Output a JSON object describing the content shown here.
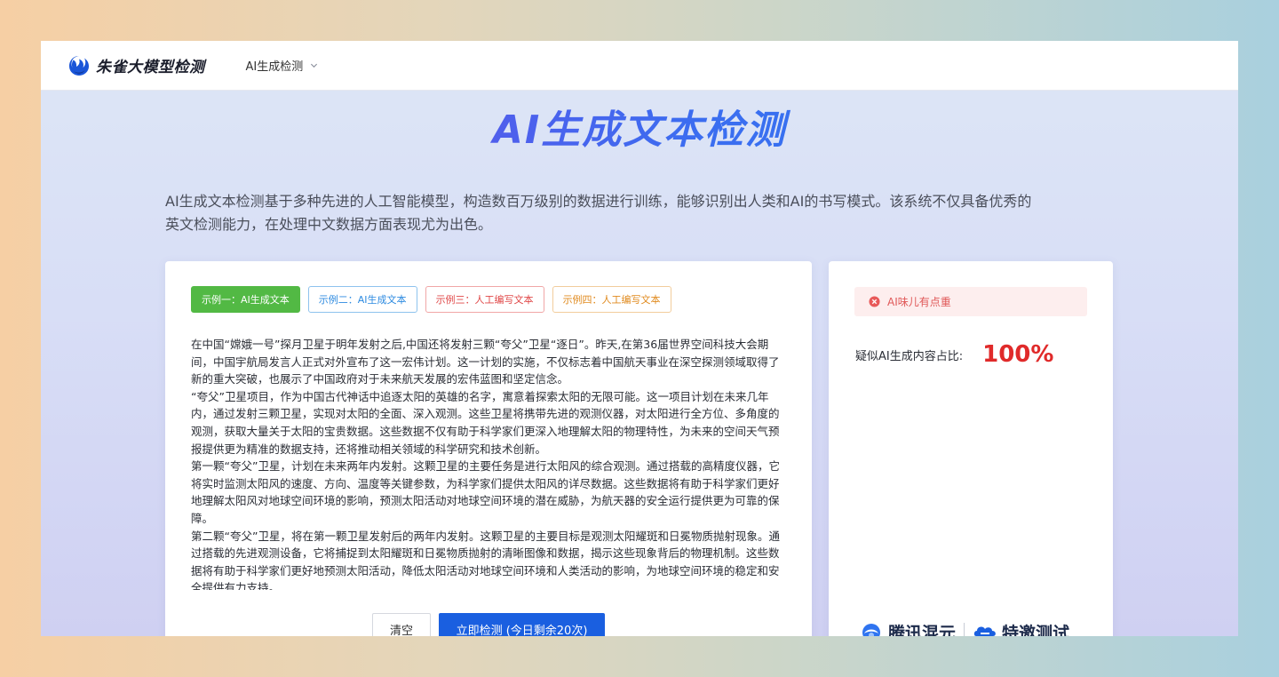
{
  "header": {
    "logo_text": "朱雀大模型检测",
    "nav_label": "AI生成检测"
  },
  "hero": {
    "title": "AI生成文本检测",
    "intro_line1": "AI生成文本检测基于多种先进的人工智能模型，构造数百万级别的数据进行训练，能够识别出人类和AI的书写模式。该系统不仅具备优秀的",
    "intro_line2": "英文检测能力，在处理中文数据方面表现尤为出色。"
  },
  "examples": [
    {
      "label": "示例一：AI生成文本",
      "color": "#52b944"
    },
    {
      "label": "示例二：AI生成文本",
      "color": "#2c8ae0"
    },
    {
      "label": "示例三：人工编写文本",
      "color": "#e04848"
    },
    {
      "label": "示例四：人工编写文本",
      "color": "#e08a1e"
    }
  ],
  "text_paragraphs": [
    "在中国“嫦娥一号”探月卫星于明年发射之后,中国还将发射三颗“夸父”卫星“逐日”。昨天,在第36届世界空间科技大会期间，中国宇航局发言人正式对外宣布了这一宏伟计划。这一计划的实施，不仅标志着中国航天事业在深空探测领域取得了新的重大突破，也展示了中国政府对于未来航天发展的宏伟蓝图和坚定信念。",
    "“夸父”卫星项目，作为中国古代神话中追逐太阳的英雄的名字，寓意着探索太阳的无限可能。这一项目计划在未来几年内，通过发射三颗卫星，实现对太阳的全面、深入观测。这些卫星将携带先进的观测仪器，对太阳进行全方位、多角度的观测，获取大量关于太阳的宝贵数据。这些数据不仅有助于科学家们更深入地理解太阳的物理特性，为未来的空间天气预报提供更为精准的数据支持，还将推动相关领域的科学研究和技术创新。",
    "第一颗“夸父”卫星，计划在未来两年内发射。这颗卫星的主要任务是进行太阳风的综合观测。通过搭载的高精度仪器，它将实时监测太阳风的速度、方向、温度等关键参数，为科学家们提供太阳风的详尽数据。这些数据将有助于科学家们更好地理解太阳风对地球空间环境的影响，预测太阳活动对地球空间环境的潜在威胁，为航天器的安全运行提供更为可靠的保障。",
    "第二颗“夸父”卫星，将在第一颗卫星发射后的两年内发射。这颗卫星的主要目标是观测太阳耀斑和日冕物质抛射现象。通过搭载的先进观测设备，它将捕捉到太阳耀斑和日冕物质抛射的清晰图像和数据，揭示这些现象背后的物理机制。这些数据将有助于科学家们更好地预测太阳活动，降低太阳活动对地球空间环境和人类活动的影响，为地球空间环境的稳定和安全提供有力支持。"
  ],
  "actions": {
    "clear_label": "清空",
    "detect_label": "立即检测 (今日剩余20次)"
  },
  "result": {
    "alert_text": "AI味儿有点重",
    "ratio_label": "疑似AI生成内容占比:",
    "ratio_value": "100%"
  },
  "brands": {
    "brand1": "腾讯混元",
    "brand2": "特邀测试"
  },
  "colors": {
    "primary": "#1a5fe0",
    "danger": "#e02a2a",
    "title_gradient_start": "#7b3fe4",
    "title_gradient_end": "#2a7df2"
  }
}
